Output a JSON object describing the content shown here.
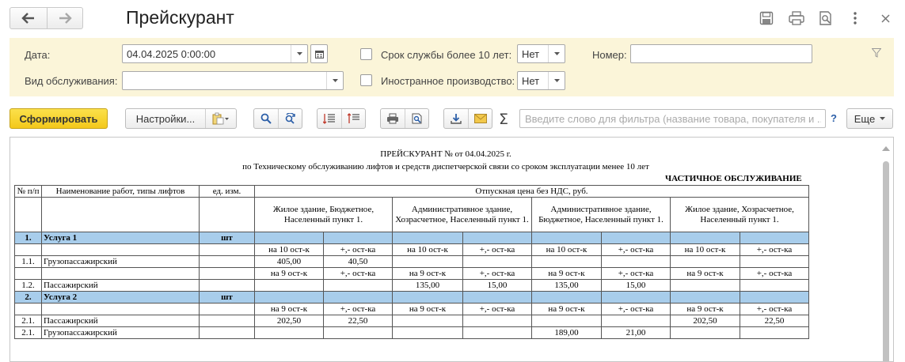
{
  "window": {
    "title": "Прейскурант"
  },
  "filters": {
    "date_label": "Дата:",
    "date_value": "04.04.2025  0:00:00",
    "service_label": "Вид обслуживания:",
    "service_value": "",
    "service_life_label": "Срок службы более 10 лет:",
    "service_life_value": "Нет",
    "foreign_label": "Иностранное производство:",
    "foreign_value": "Нет",
    "number_label": "Номер:",
    "number_value": ""
  },
  "commands": {
    "generate": "Сформировать",
    "settings": "Настройки...",
    "search_placeholder": "Введите слово для фильтра (название товара, покупателя и ...",
    "help": "?",
    "more": "Еще",
    "sum_symbol": "Σ"
  },
  "report": {
    "heading": "ПРЕЙСКУРАНТ №  от 04.04.2025 г.",
    "subheading": "по Техническому обслуживанию лифтов и средств диспетчерской связи со сроком эксплуатации менее 10 лет",
    "partial": "ЧАСТИЧНОЕ ОБСЛУЖИВАНИЕ",
    "headers": {
      "num": "№ п/п",
      "name": "Наименование работ, типы лифтов",
      "unit": "ед. изм.",
      "price": "Отпускная цена без НДС, руб."
    },
    "categories": [
      "Жилое здание, Бюджетное, Населенный пункт 1.",
      "Административное здание, Хозрасчетное, Населенный пункт 1.",
      "Административное здание, Бюджетное, Населенный пункт 1.",
      "Жилое здание, Хозрасчетное, Населенный пункт 1."
    ],
    "rows": [
      {
        "type": "group",
        "cells": [
          "1.",
          "Услуга 1",
          "шт",
          "",
          "",
          "",
          "",
          "",
          "",
          "",
          ""
        ]
      },
      {
        "type": "sub",
        "cells": [
          "",
          "",
          "",
          "на 10 ост-к",
          "+,- ост-ка",
          "на 10 ост-к",
          "+,- ост-ка",
          "на 10 ост-к",
          "+,- ост-ка",
          "на 10 ост-к",
          "+,- ост-ка"
        ]
      },
      {
        "type": "data",
        "cells": [
          "1.1.",
          "Грузопассажирский",
          "",
          "405,00",
          "40,50",
          "",
          "",
          "",
          "",
          "",
          ""
        ]
      },
      {
        "type": "sub",
        "cells": [
          "",
          "",
          "",
          "на 9 ост-к",
          "+,- ост-ка",
          "на 9 ост-к",
          "+,- ост-ка",
          "на 9 ост-к",
          "+,- ост-ка",
          "на 9 ост-к",
          "+,- ост-ка"
        ]
      },
      {
        "type": "data",
        "cells": [
          "1.2.",
          "Пассажирский",
          "",
          "",
          "",
          "135,00",
          "15,00",
          "135,00",
          "15,00",
          "",
          ""
        ]
      },
      {
        "type": "group",
        "cells": [
          "2.",
          "Услуга 2",
          "шт",
          "",
          "",
          "",
          "",
          "",
          "",
          "",
          ""
        ]
      },
      {
        "type": "sub",
        "cells": [
          "",
          "",
          "",
          "на 9 ост-к",
          "+,- ост-ка",
          "на 9 ост-к",
          "+,- ост-ка",
          "на 9 ост-к",
          "+,- ост-ка",
          "на 9 ост-к",
          "+,- ост-ка"
        ]
      },
      {
        "type": "data",
        "cells": [
          "2.1.",
          "Пассажирский",
          "",
          "202,50",
          "22,50",
          "",
          "",
          "",
          "",
          "202,50",
          "22,50"
        ]
      },
      {
        "type": "data",
        "cells": [
          "2.1.",
          "Грузопассажирский",
          "",
          "",
          "",
          "",
          "",
          "189,00",
          "21,00",
          "",
          ""
        ]
      }
    ]
  }
}
